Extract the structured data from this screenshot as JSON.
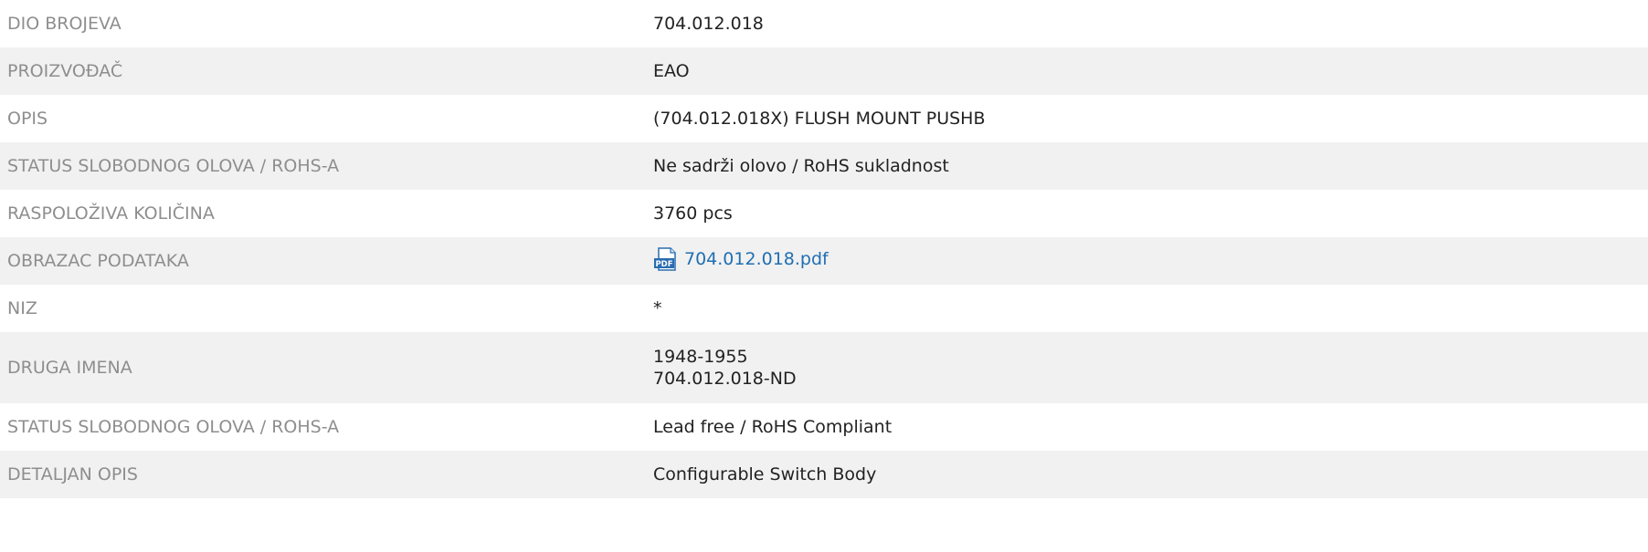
{
  "colors": {
    "label_text": "#8e8e8e",
    "value_text": "#222222",
    "link": "#1f6fb2",
    "row_shade": "#f1f1f1"
  },
  "rows": [
    {
      "label": "DIO BROJEVA",
      "value": "704.012.018"
    },
    {
      "label": "PROIZVOĐAČ",
      "value": "EAO"
    },
    {
      "label": "OPIS",
      "value": "(704.012.018X) FLUSH MOUNT PUSHB"
    },
    {
      "label": "STATUS SLOBODNOG OLOVA / ROHS-A",
      "value": "Ne sadrži olovo / RoHS sukladnost"
    },
    {
      "label": "RASPOLOŽIVA KOLIČINA",
      "value": "3760 pcs"
    },
    {
      "label": "OBRAZAC PODATAKA",
      "link_text": "704.012.018.pdf",
      "icon": "pdf-file-icon",
      "icon_text": "PDF"
    },
    {
      "label": "NIZ",
      "value": "*"
    },
    {
      "label": "DRUGA IMENA",
      "lines": [
        "1948-1955",
        "704.012.018-ND"
      ]
    },
    {
      "label": "STATUS SLOBODNOG OLOVA / ROHS-A",
      "value": "Lead free / RoHS Compliant"
    },
    {
      "label": "DETALJAN OPIS",
      "value": "Configurable Switch Body"
    }
  ]
}
